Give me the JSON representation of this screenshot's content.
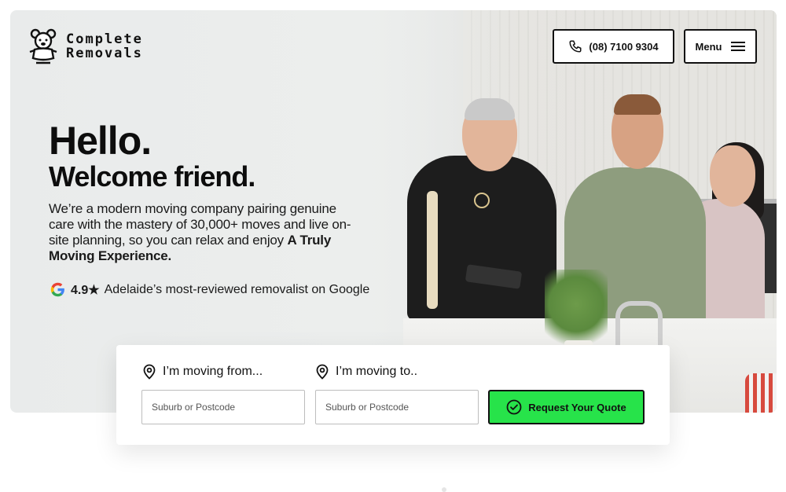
{
  "header": {
    "logo_line1": "Complete",
    "logo_line2": "Removals",
    "phone_label": "(08) 7100 9304",
    "menu_label": "Menu"
  },
  "hero": {
    "heading": "Hello.",
    "subheading": "Welcome friend.",
    "intro_text": "We’re a modern moving company pairing genuine care with the mastery of 30,000+ moves and live on-site planning, so you can relax and enjoy ",
    "intro_bold": "A Truly Moving Experience.",
    "rating_score": "4.9★",
    "rating_text": "Adelaide’s most-reviewed removalist on Google"
  },
  "quote": {
    "from_label": "I’m moving from...",
    "to_label": "I’m moving to..",
    "from_placeholder": "Suburb or Postcode",
    "to_placeholder": "Suburb or Postcode",
    "submit_label": "Request Your Quote"
  },
  "icons": {
    "logo": "teddy-bear-logo-icon",
    "phone": "phone-icon",
    "menu": "hamburger-menu-icon",
    "google": "google-g-icon",
    "pin": "map-pin-icon",
    "check": "check-circle-icon"
  },
  "colors": {
    "accent": "#27e34a",
    "text": "#111111",
    "hero_bg": "#eceeed"
  }
}
